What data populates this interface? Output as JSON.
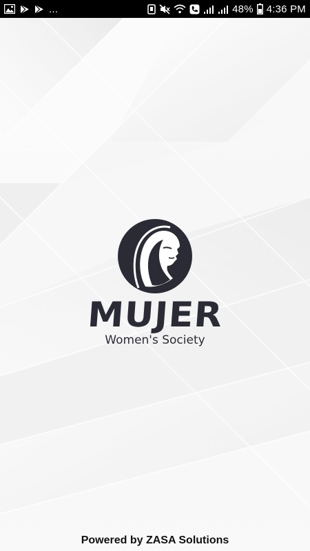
{
  "status_bar": {
    "battery_percent": "48%",
    "time": "4:36 PM",
    "overflow": "...",
    "icons": [
      "image-icon",
      "play-store-icon",
      "play-store-icon",
      "nfc-icon",
      "mute-icon",
      "wifi-icon",
      "call-icon",
      "signal-icon",
      "signal-icon",
      "battery-icon"
    ]
  },
  "splash": {
    "brand_name": "MUJER",
    "tagline": "Women's Society",
    "logo_icon": "woman-face-icon"
  },
  "footer": {
    "powered_by": "Powered by ZASA Solutions"
  },
  "colors": {
    "status_bar_bg": "#000000",
    "brand_dark": "#2b2b36",
    "background": "#f4f4f4"
  }
}
